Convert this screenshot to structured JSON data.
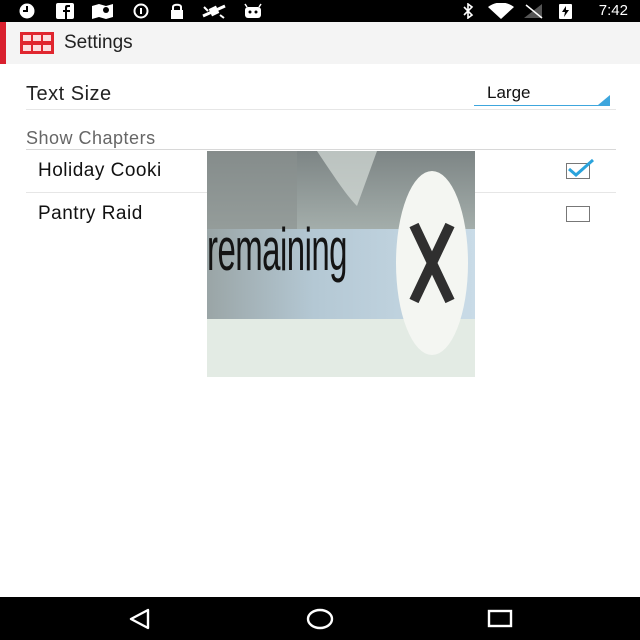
{
  "status_bar": {
    "time": "7:42",
    "left_icons": [
      "clock-icon",
      "facebook-icon",
      "maps-icon",
      "info-icon",
      "lock-icon",
      "satellite-icon",
      "android-icon"
    ],
    "right_icons": [
      "bluetooth-icon",
      "wifi-icon",
      "signal-icon",
      "battery-charging-icon"
    ]
  },
  "action_bar": {
    "title": "Settings",
    "accent_color": "#d9202e"
  },
  "settings": {
    "text_size": {
      "label": "Text Size",
      "value": "Large"
    },
    "show_chapters": {
      "header": "Show Chapters",
      "items": [
        {
          "label": "Holiday Cooki",
          "checked": true
        },
        {
          "label": "Pantry Raid",
          "checked": false
        }
      ]
    }
  },
  "overlay_ad": {
    "text": "remaining",
    "close_label": "X"
  },
  "nav_bar": {
    "buttons": [
      "back-icon",
      "home-icon",
      "recents-icon"
    ]
  }
}
